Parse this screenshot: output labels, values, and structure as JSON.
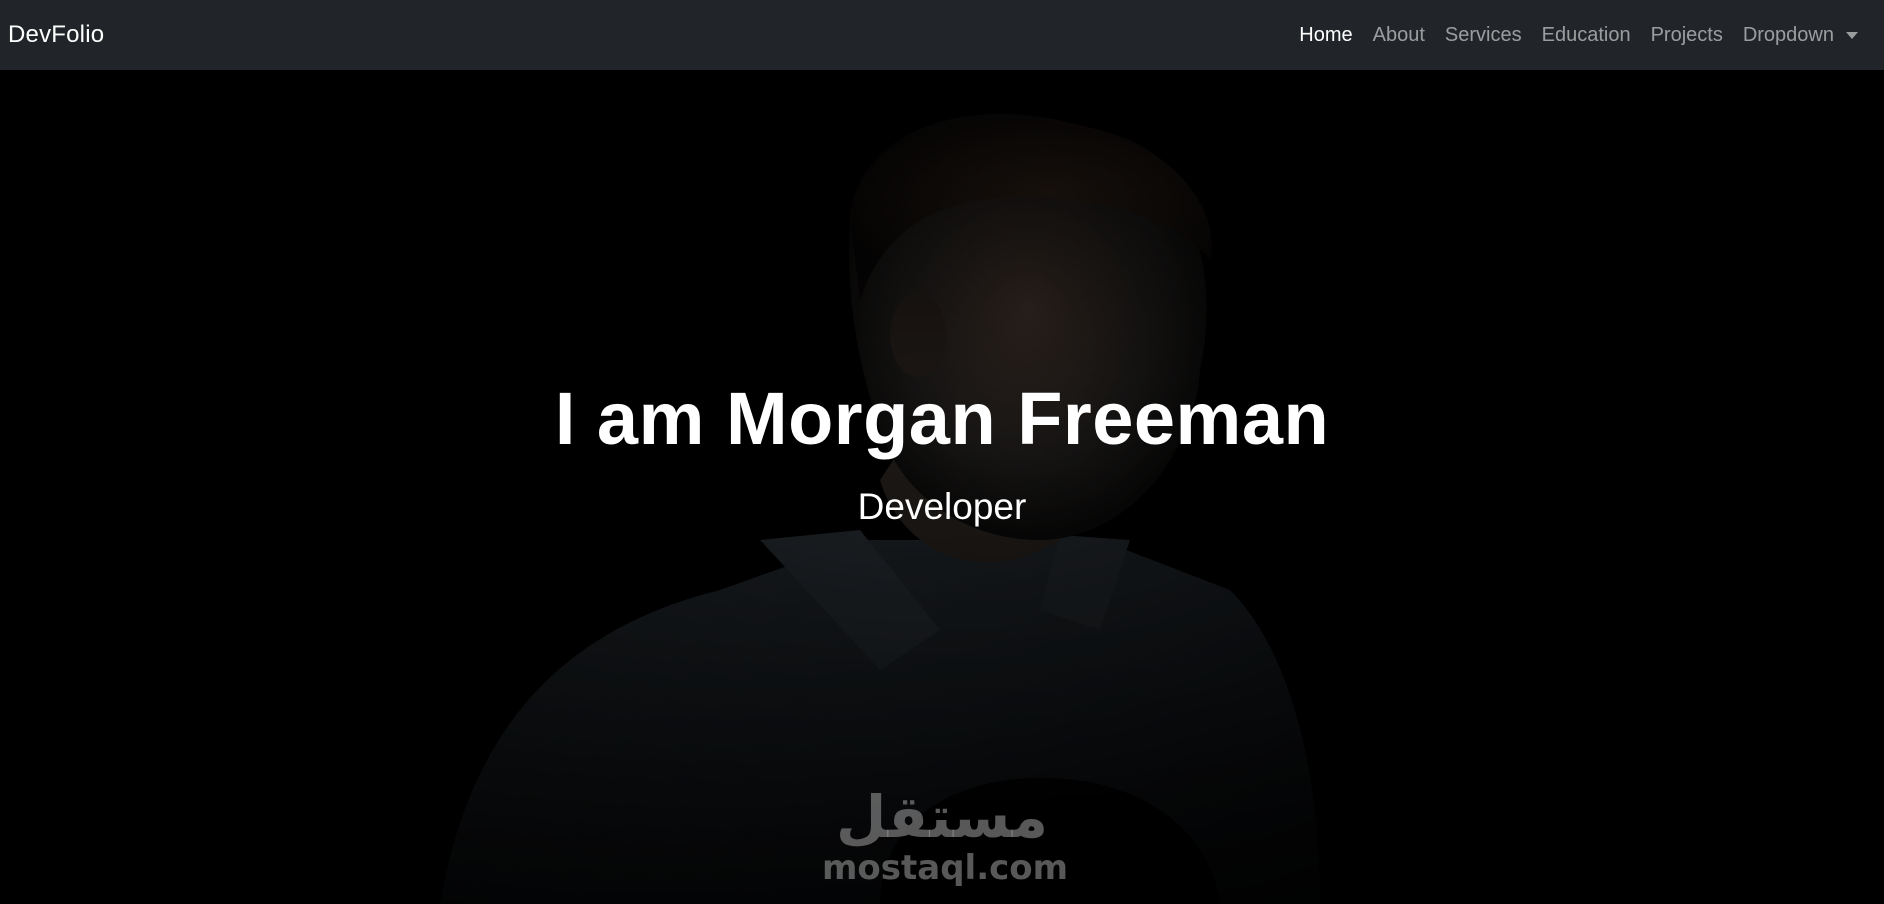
{
  "navbar": {
    "brand": "DevFolio",
    "links": [
      {
        "label": "Home",
        "active": true
      },
      {
        "label": "About"
      },
      {
        "label": "Services"
      },
      {
        "label": "Education"
      },
      {
        "label": "Projects"
      },
      {
        "label": "Dropdown"
      }
    ]
  },
  "hero": {
    "title": "I am Morgan Freeman",
    "subtitle": "Developer"
  },
  "watermark": {
    "arabic": "مستقل",
    "latin": "mostaql.com"
  },
  "colors": {
    "navbar_bg": "#212529",
    "hero_bg": "#000000",
    "text_primary": "#ffffff",
    "text_muted": "rgba(255,255,255,0.55)"
  }
}
